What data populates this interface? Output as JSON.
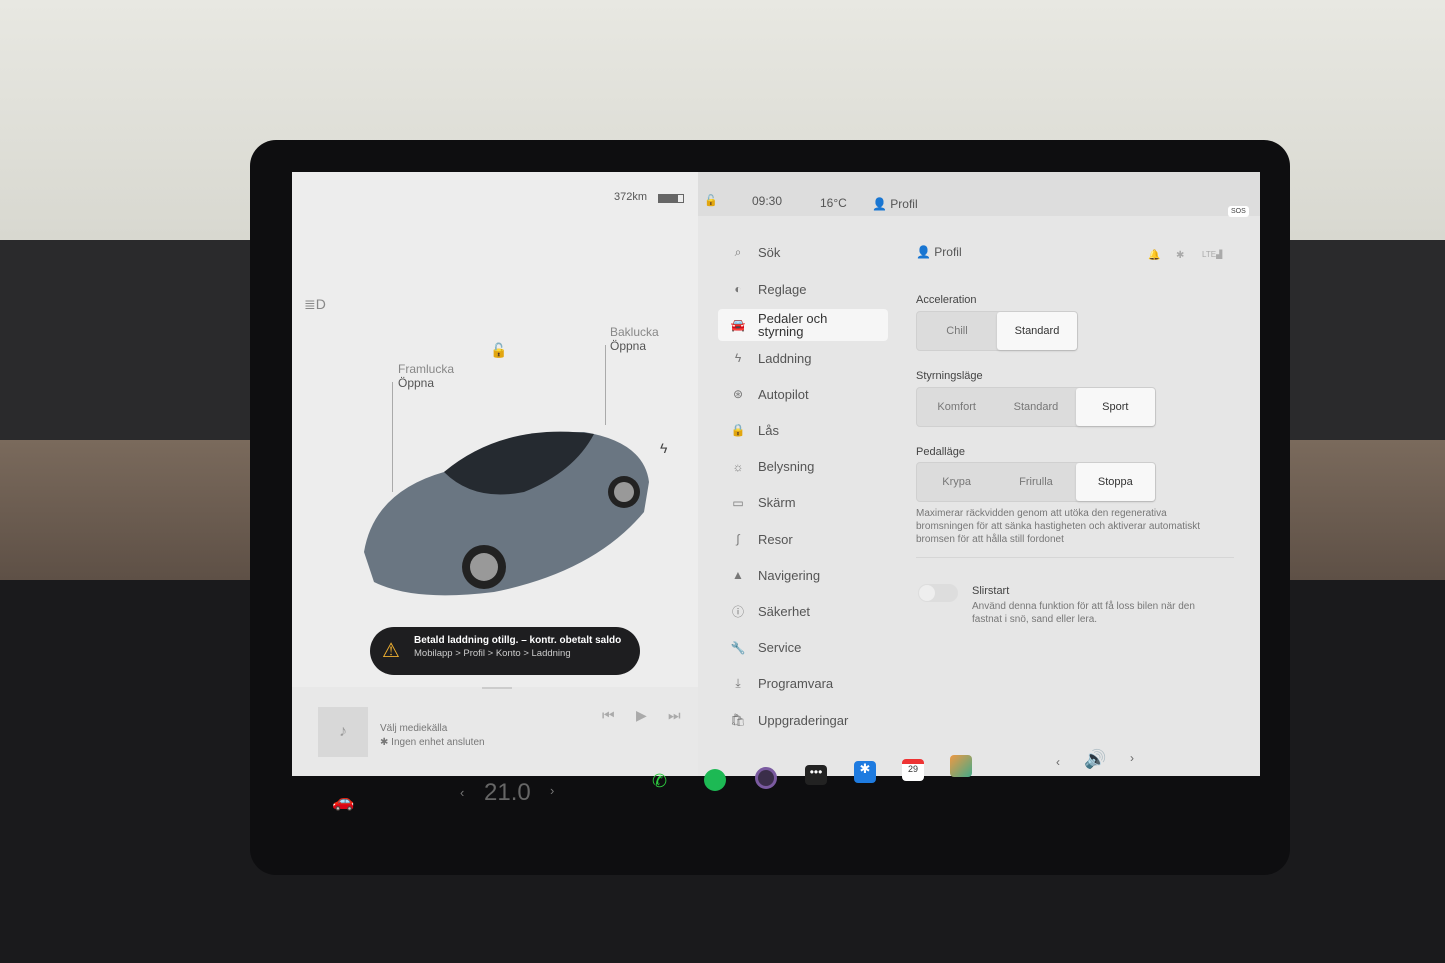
{
  "status": {
    "range": "372km",
    "time": "09:30",
    "temp": "16°C",
    "profile": "Profil",
    "sos": "SOS"
  },
  "car": {
    "frunk_label": "Framlucka",
    "frunk_action": "Öppna",
    "trunk_label": "Baklucka",
    "trunk_action": "Öppna"
  },
  "alert": {
    "title": "Betald laddning otillg. – kontr. obetalt saldo",
    "path": "Mobilapp > Profil > Konto > Laddning"
  },
  "media": {
    "source": "Välj mediekälla",
    "device": "Ingen enhet ansluten"
  },
  "menu": [
    {
      "label": "Sök",
      "icon": "search-icon",
      "glyph": "⌕"
    },
    {
      "label": "Reglage",
      "icon": "toggle-icon",
      "glyph": "◐"
    },
    {
      "label": "Pedaler och styrning",
      "icon": "car-icon",
      "glyph": "🚘",
      "active": true
    },
    {
      "label": "Laddning",
      "icon": "bolt-icon",
      "glyph": "ϟ"
    },
    {
      "label": "Autopilot",
      "icon": "steering-wheel-icon",
      "glyph": "⊛"
    },
    {
      "label": "Lås",
      "icon": "lock-icon",
      "glyph": "🔒"
    },
    {
      "label": "Belysning",
      "icon": "sun-icon",
      "glyph": "☼"
    },
    {
      "label": "Skärm",
      "icon": "display-icon",
      "glyph": "▭"
    },
    {
      "label": "Resor",
      "icon": "trips-icon",
      "glyph": "∫"
    },
    {
      "label": "Navigering",
      "icon": "navigation-icon",
      "glyph": "▲"
    },
    {
      "label": "Säkerhet",
      "icon": "safety-icon",
      "glyph": "ⓘ"
    },
    {
      "label": "Service",
      "icon": "wrench-icon",
      "glyph": "🔧"
    },
    {
      "label": "Programvara",
      "icon": "download-icon",
      "glyph": "⤓"
    },
    {
      "label": "Uppgraderingar",
      "icon": "bag-icon",
      "glyph": "🛍"
    }
  ],
  "settings": {
    "header": "Profil",
    "acceleration": {
      "label": "Acceleration",
      "options": [
        "Chill",
        "Standard"
      ],
      "selected": "Standard"
    },
    "steering": {
      "label": "Styrningsläge",
      "options": [
        "Komfort",
        "Standard",
        "Sport"
      ],
      "selected": "Sport"
    },
    "pedal": {
      "label": "Pedalläge",
      "options": [
        "Krypa",
        "Frirulla",
        "Stoppa"
      ],
      "selected": "Stoppa"
    },
    "pedal_desc": "Maximerar räckvidden genom att utöka den regenerativa bromsningen för att sänka hastigheten och aktiverar automatiskt bromsen för att hålla still fordonet",
    "slirstart": {
      "label": "Slirstart",
      "desc": "Använd denna funktion för att få loss bilen när den fastnat i snö, sand eller lera.",
      "enabled": false
    }
  },
  "taskbar": {
    "temperature": "21.0",
    "calendar_day": "29"
  }
}
